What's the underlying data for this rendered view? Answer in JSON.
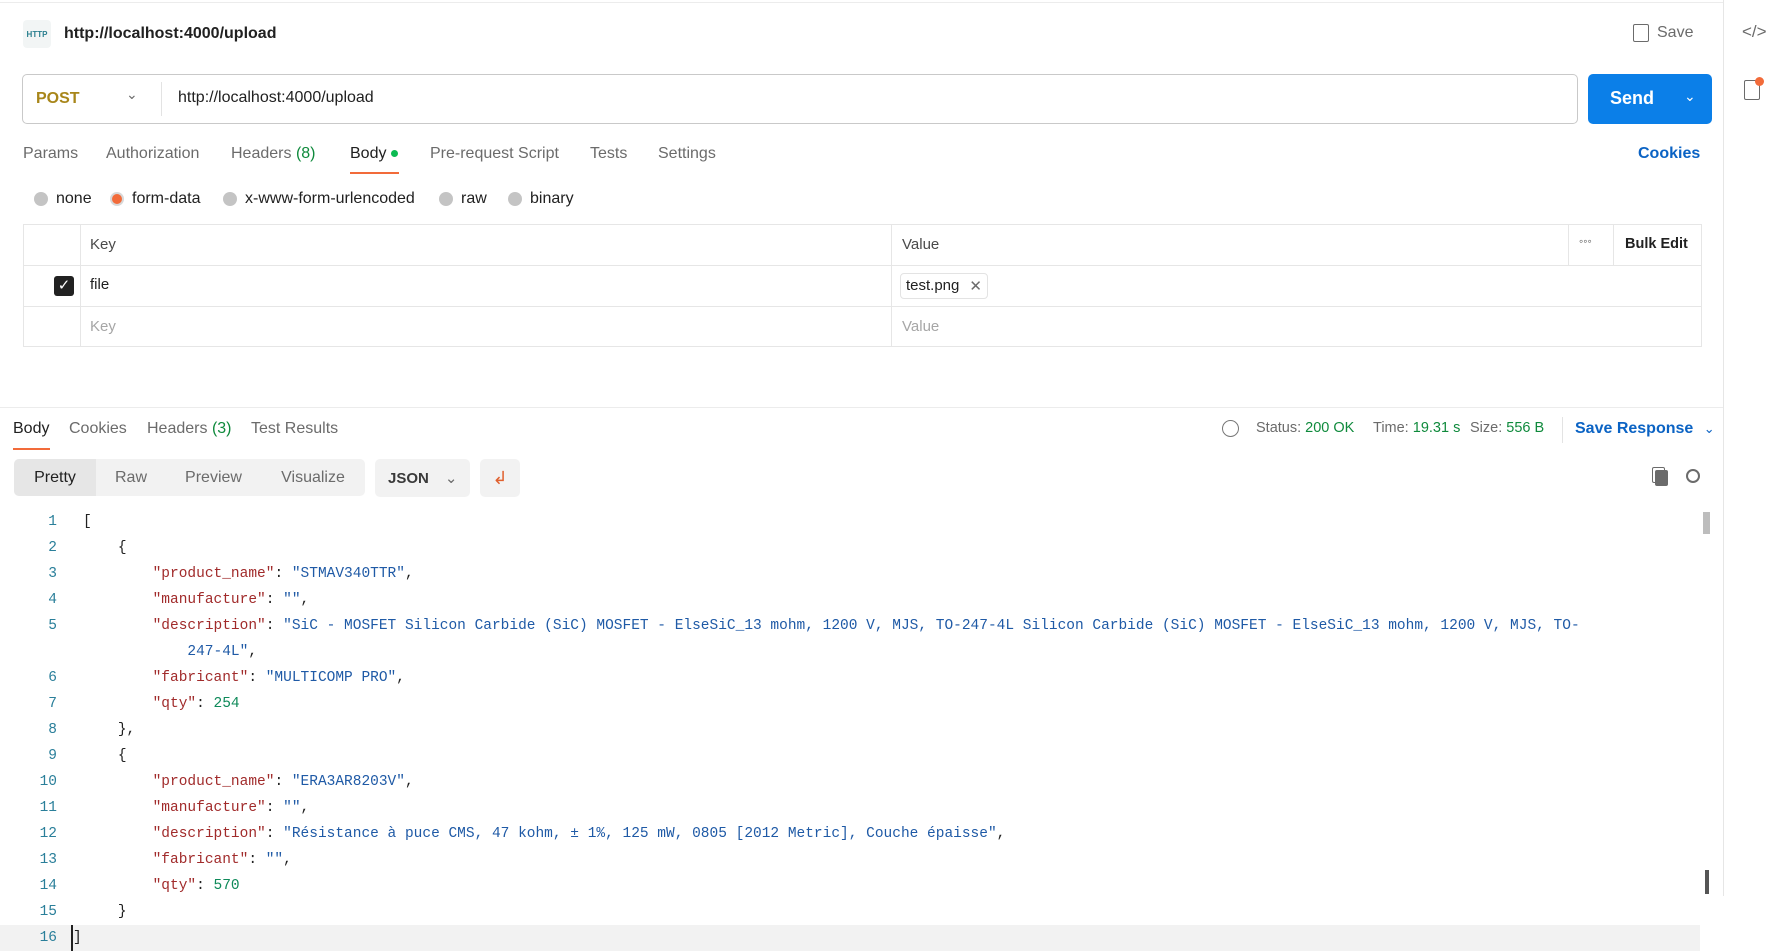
{
  "header": {
    "title": "http://localhost:4000/upload",
    "icon": "http-request-icon",
    "icon_text": "HTTP",
    "save_label": "Save"
  },
  "request": {
    "method": "POST",
    "url": "http://localhost:4000/upload",
    "send_label": "Send"
  },
  "tabs": [
    {
      "label": "Params"
    },
    {
      "label": "Authorization"
    },
    {
      "label": "Headers",
      "count": "(8)"
    },
    {
      "label": "Body",
      "active": true
    },
    {
      "label": "Pre-request Script"
    },
    {
      "label": "Tests"
    },
    {
      "label": "Settings"
    }
  ],
  "cookies_label": "Cookies",
  "body_types": [
    {
      "label": "none"
    },
    {
      "label": "form-data",
      "selected": true
    },
    {
      "label": "x-www-form-urlencoded"
    },
    {
      "label": "raw"
    },
    {
      "label": "binary"
    }
  ],
  "form_table": {
    "headers": {
      "key": "Key",
      "value": "Value",
      "bulk_edit": "Bulk Edit"
    },
    "rows": [
      {
        "checked": true,
        "key": "file",
        "value": "test.png"
      }
    ],
    "placeholder": {
      "key": "Key",
      "value": "Value"
    }
  },
  "response": {
    "tabs": [
      {
        "label": "Body",
        "active": true
      },
      {
        "label": "Cookies"
      },
      {
        "label": "Headers",
        "count": "(3)"
      },
      {
        "label": "Test Results"
      }
    ],
    "status_label": "Status:",
    "status": "200 OK",
    "time_label": "Time:",
    "time": "19.31 s",
    "size_label": "Size:",
    "size": "556 B",
    "save_response": "Save Response",
    "views": [
      "Pretty",
      "Raw",
      "Preview",
      "Visualize"
    ],
    "active_view": "Pretty",
    "format": "JSON",
    "lines": [
      {
        "n": "1",
        "i": 0,
        "t": [
          [
            "p",
            "["
          ]
        ]
      },
      {
        "n": "2",
        "i": 4,
        "t": [
          [
            "p",
            "{"
          ]
        ]
      },
      {
        "n": "3",
        "i": 8,
        "t": [
          [
            "k",
            "\"product_name\""
          ],
          [
            "p",
            ": "
          ],
          [
            "s",
            "\"STMAV340TTR\""
          ],
          [
            "p",
            ","
          ]
        ]
      },
      {
        "n": "4",
        "i": 8,
        "t": [
          [
            "k",
            "\"manufacture\""
          ],
          [
            "p",
            ": "
          ],
          [
            "s",
            "\"\""
          ],
          [
            "p",
            ","
          ]
        ]
      },
      {
        "n": "5",
        "i": 8,
        "t": [
          [
            "k",
            "\"description\""
          ],
          [
            "p",
            ": "
          ],
          [
            "s",
            "\"SiC - MOSFET Silicon Carbide (SiC) MOSFET - ElseSiC_13 mohm, 1200 V, MJS, TO-247-4L Silicon Carbide (SiC) MOSFET - ElseSiC_13 mohm, 1200 V, MJS, TO-247-4L\""
          ],
          [
            "p",
            ","
          ]
        ]
      },
      {
        "n": "6",
        "i": 8,
        "t": [
          [
            "k",
            "\"fabricant\""
          ],
          [
            "p",
            ": "
          ],
          [
            "s",
            "\"MULTICOMP PRO\""
          ],
          [
            "p",
            ","
          ]
        ]
      },
      {
        "n": "7",
        "i": 8,
        "t": [
          [
            "k",
            "\"qty\""
          ],
          [
            "p",
            ": "
          ],
          [
            "n",
            "254"
          ]
        ]
      },
      {
        "n": "8",
        "i": 4,
        "t": [
          [
            "p",
            "},"
          ]
        ]
      },
      {
        "n": "9",
        "i": 4,
        "t": [
          [
            "p",
            "{"
          ]
        ]
      },
      {
        "n": "10",
        "i": 8,
        "t": [
          [
            "k",
            "\"product_name\""
          ],
          [
            "p",
            ": "
          ],
          [
            "s",
            "\"ERA3AR8203V\""
          ],
          [
            "p",
            ","
          ]
        ]
      },
      {
        "n": "11",
        "i": 8,
        "t": [
          [
            "k",
            "\"manufacture\""
          ],
          [
            "p",
            ": "
          ],
          [
            "s",
            "\"\""
          ],
          [
            "p",
            ","
          ]
        ]
      },
      {
        "n": "12",
        "i": 8,
        "t": [
          [
            "k",
            "\"description\""
          ],
          [
            "p",
            ": "
          ],
          [
            "s",
            "\"Résistance à puce CMS, 47 kohm, ± 1%, 125 mW, 0805 [2012 Metric], Couche épaisse\""
          ],
          [
            "p",
            ","
          ]
        ]
      },
      {
        "n": "13",
        "i": 8,
        "t": [
          [
            "k",
            "\"fabricant\""
          ],
          [
            "p",
            ": "
          ],
          [
            "s",
            "\"\""
          ],
          [
            "p",
            ","
          ]
        ]
      },
      {
        "n": "14",
        "i": 8,
        "t": [
          [
            "k",
            "\"qty\""
          ],
          [
            "p",
            ": "
          ],
          [
            "n",
            "570"
          ]
        ]
      },
      {
        "n": "15",
        "i": 4,
        "t": [
          [
            "p",
            "}"
          ]
        ]
      },
      {
        "n": "16",
        "i": 0,
        "t": [
          [
            "p",
            "]"
          ]
        ],
        "current": true
      }
    ]
  },
  "colors": {
    "accent": "#f26b3a",
    "send": "#0b7fe8",
    "link": "#0b63c4",
    "success": "#0f8a3c"
  }
}
